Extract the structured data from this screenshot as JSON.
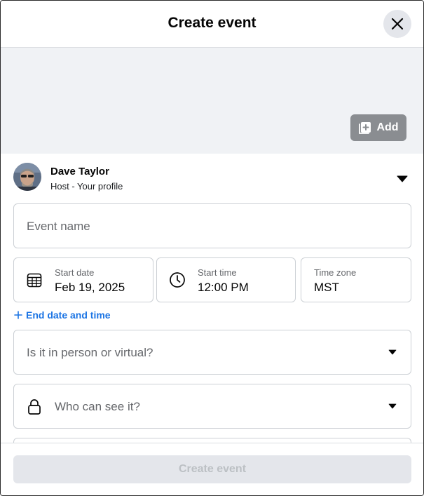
{
  "header": {
    "title": "Create event"
  },
  "cover": {
    "add_label": "Add"
  },
  "host": {
    "name": "Dave Taylor",
    "subtitle": "Host - Your profile"
  },
  "form": {
    "event_name": {
      "placeholder": "Event name"
    },
    "start_date": {
      "label": "Start date",
      "value": "Feb 19, 2025"
    },
    "start_time": {
      "label": "Start time",
      "value": "12:00 PM"
    },
    "time_zone": {
      "label": "Time zone",
      "value": "MST"
    },
    "end_date_link": "End date and time",
    "location_type": {
      "placeholder": "Is it in person or virtual?"
    },
    "privacy": {
      "placeholder": "Who can see it?"
    }
  },
  "footer": {
    "submit_label": "Create event"
  },
  "colors": {
    "accent": "#1b74e4",
    "field_border": "#ccd0d5",
    "cover_bg": "#f0f2f5",
    "add_button_bg": "#8a8d91",
    "disabled_button_bg": "#e4e6eb"
  },
  "icons": {
    "close": "close-icon",
    "add_photo": "add-photo-icon",
    "host_dropdown": "caret-down-icon",
    "calendar": "calendar-icon",
    "clock": "clock-icon",
    "plus": "plus-icon",
    "lock": "lock-icon"
  }
}
